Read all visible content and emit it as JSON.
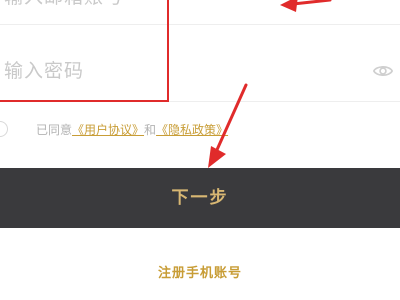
{
  "email_field": {
    "placeholder": "输入邮箱账号"
  },
  "password_field": {
    "placeholder": "输入密码",
    "toggle_icon": "eye-icon"
  },
  "agreement": {
    "prefix": "已同意",
    "user_agreement": "《用户协议》",
    "connector": "和",
    "privacy_policy": "《隐私政策》"
  },
  "actions": {
    "next_label": "下一步",
    "register_label": "注册手机账号"
  },
  "colors": {
    "accent": "#c89d36",
    "button_bg": "#3a3a3d",
    "button_text": "#d8b773",
    "annotation": "#e02b2b"
  }
}
